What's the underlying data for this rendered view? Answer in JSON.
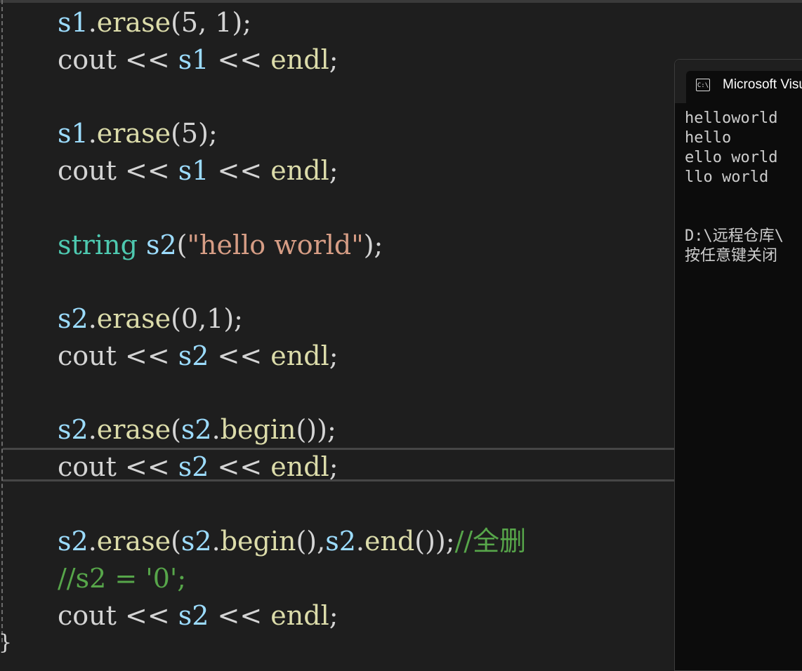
{
  "editor": {
    "closing_brace": "}",
    "lines": [
      {
        "parts": [
          {
            "t": "s1",
            "c": "var"
          },
          {
            "t": ".",
            "c": "op"
          },
          {
            "t": "erase",
            "c": "fn"
          },
          {
            "t": "(5, 1);",
            "c": "op"
          }
        ]
      },
      {
        "parts": [
          {
            "t": "cout",
            "c": "op"
          },
          {
            "t": " << ",
            "c": "op"
          },
          {
            "t": "s1",
            "c": "var"
          },
          {
            "t": " << ",
            "c": "op"
          },
          {
            "t": "endl",
            "c": "fn"
          },
          {
            "t": ";",
            "c": "op"
          }
        ]
      },
      {
        "parts": [
          {
            "t": "s1",
            "c": "var"
          },
          {
            "t": ".",
            "c": "op"
          },
          {
            "t": "erase",
            "c": "fn"
          },
          {
            "t": "(5);",
            "c": "op"
          }
        ]
      },
      {
        "parts": [
          {
            "t": "cout",
            "c": "op"
          },
          {
            "t": " << ",
            "c": "op"
          },
          {
            "t": "s1",
            "c": "var"
          },
          {
            "t": " << ",
            "c": "op"
          },
          {
            "t": "endl",
            "c": "fn"
          },
          {
            "t": ";",
            "c": "op"
          }
        ]
      },
      {
        "parts": [
          {
            "t": "string",
            "c": "type"
          },
          {
            "t": " ",
            "c": "op"
          },
          {
            "t": "s2",
            "c": "var"
          },
          {
            "t": "(",
            "c": "op"
          },
          {
            "t": "\"hello world\"",
            "c": "str"
          },
          {
            "t": ");",
            "c": "op"
          }
        ]
      },
      {
        "parts": [
          {
            "t": "s2",
            "c": "var"
          },
          {
            "t": ".",
            "c": "op"
          },
          {
            "t": "erase",
            "c": "fn"
          },
          {
            "t": "(0,1);",
            "c": "op"
          }
        ]
      },
      {
        "parts": [
          {
            "t": "cout",
            "c": "op"
          },
          {
            "t": " << ",
            "c": "op"
          },
          {
            "t": "s2",
            "c": "var"
          },
          {
            "t": " << ",
            "c": "op"
          },
          {
            "t": "endl",
            "c": "fn"
          },
          {
            "t": ";",
            "c": "op"
          }
        ]
      },
      {
        "parts": [
          {
            "t": "s2",
            "c": "var"
          },
          {
            "t": ".",
            "c": "op"
          },
          {
            "t": "erase",
            "c": "fn"
          },
          {
            "t": "(",
            "c": "op"
          },
          {
            "t": "s2",
            "c": "var"
          },
          {
            "t": ".",
            "c": "op"
          },
          {
            "t": "begin",
            "c": "fn"
          },
          {
            "t": "());",
            "c": "op"
          }
        ]
      },
      {
        "parts": [
          {
            "t": "cout",
            "c": "op"
          },
          {
            "t": " << ",
            "c": "op"
          },
          {
            "t": "s2",
            "c": "var"
          },
          {
            "t": " << ",
            "c": "op"
          },
          {
            "t": "endl",
            "c": "fn"
          },
          {
            "t": ";",
            "c": "op"
          }
        ]
      },
      {
        "parts": [
          {
            "t": "s2",
            "c": "var"
          },
          {
            "t": ".",
            "c": "op"
          },
          {
            "t": "erase",
            "c": "fn"
          },
          {
            "t": "(",
            "c": "op"
          },
          {
            "t": "s2",
            "c": "var"
          },
          {
            "t": ".",
            "c": "op"
          },
          {
            "t": "begin",
            "c": "fn"
          },
          {
            "t": "(),",
            "c": "op"
          },
          {
            "t": "s2",
            "c": "var"
          },
          {
            "t": ".",
            "c": "op"
          },
          {
            "t": "end",
            "c": "fn"
          },
          {
            "t": "());",
            "c": "op"
          },
          {
            "t": "//全删",
            "c": "cmt"
          }
        ]
      },
      {
        "parts": [
          {
            "t": "//s2 = '0';",
            "c": "cmt"
          }
        ]
      },
      {
        "parts": [
          {
            "t": "cout",
            "c": "op"
          },
          {
            "t": " << ",
            "c": "op"
          },
          {
            "t": "s2",
            "c": "var"
          },
          {
            "t": " << ",
            "c": "op"
          },
          {
            "t": "endl",
            "c": "fn"
          },
          {
            "t": ";",
            "c": "op"
          }
        ]
      }
    ]
  },
  "console": {
    "title": "Microsoft Visu",
    "icon": "cmd-icon",
    "icon_text": "C:\\",
    "output": "helloworld\nhello\nello world\nllo world\n\n\nD:\\远程仓库\\\n按任意键关闭"
  },
  "colors": {
    "background": "#1e1e1e",
    "variable": "#9cdcfe",
    "function": "#dcdcaa",
    "type": "#4ec9b0",
    "string": "#d69d85",
    "comment": "#57a64a",
    "console_bg": "#0c0c0c"
  }
}
